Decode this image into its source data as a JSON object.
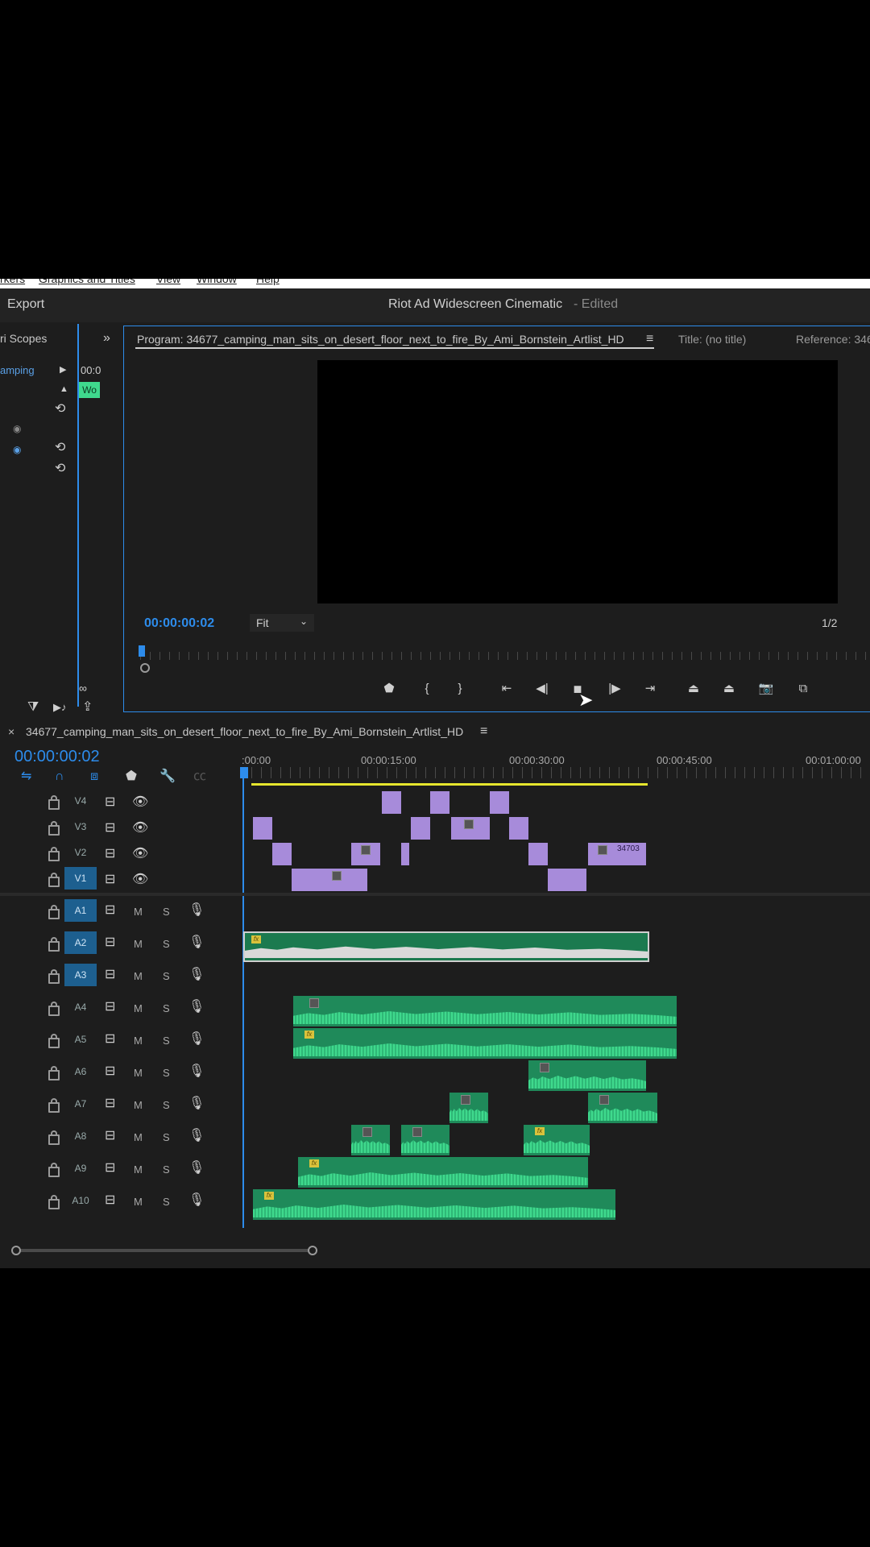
{
  "menu": [
    "rkers",
    "Graphics and Titles",
    "View",
    "Window",
    "Help"
  ],
  "topbar": {
    "export_label": "Export",
    "project_title": "Riot Ad Widescreen Cinematic",
    "edited_label": "- Edited"
  },
  "left_panel": {
    "tab_label": "ri Scopes",
    "item_label": "amping",
    "time_snip": "00:0",
    "clip_snip": "Wo"
  },
  "program": {
    "tab_label": "Program: 34677_camping_man_sits_on_desert_floor_next_to_fire_By_Ami_Bornstein_Artlist_HD",
    "title_tab": "Title: (no title)",
    "reference_tab": "Reference: 346",
    "timecode": "00:00:00:02",
    "fit_label": "Fit",
    "resolution": "1/2"
  },
  "timeline": {
    "tab_label": "34677_camping_man_sits_on_desert_floor_next_to_fire_By_Ami_Bornstein_Artlist_HD",
    "timecode": "00:00:00:02",
    "ruler": [
      ":00:00",
      "00:00:15:00",
      "00:00:30:00",
      "00:00:45:00",
      "00:01:00:00"
    ],
    "video_tracks": [
      "V4",
      "V3",
      "V2",
      "V1"
    ],
    "audio_tracks": [
      "A1",
      "A2",
      "A3",
      "A4",
      "A5",
      "A6",
      "A7",
      "A8",
      "A9",
      "A10"
    ],
    "mute_label": "M",
    "solo_label": "S",
    "clip_label": "34703"
  },
  "colors": {
    "accent_blue": "#2d8ceb",
    "video_clip": "#a78bda",
    "audio_clip": "#1f8a5a",
    "work_area": "#e6e62e"
  }
}
